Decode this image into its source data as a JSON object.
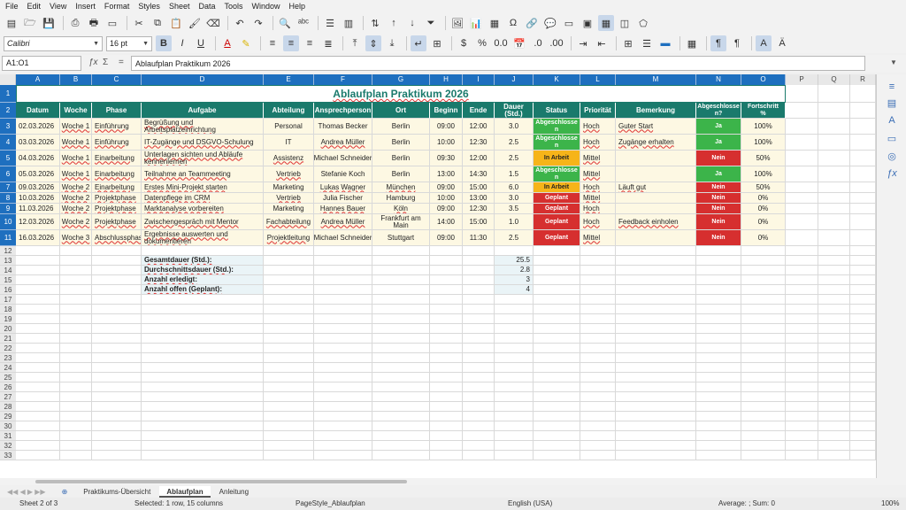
{
  "menu": [
    "File",
    "Edit",
    "View",
    "Insert",
    "Format",
    "Styles",
    "Sheet",
    "Data",
    "Tools",
    "Window",
    "Help"
  ],
  "font_name": "Calibri",
  "font_size": "16 pt",
  "name_box": "A1:O1",
  "formula": "Ablaufplan Praktikum 2026",
  "columns": [
    "A",
    "B",
    "C",
    "D",
    "E",
    "F",
    "G",
    "H",
    "I",
    "J",
    "K",
    "L",
    "M",
    "N",
    "O",
    "P",
    "Q",
    "R"
  ],
  "title": "Ablaufplan Praktikum 2026",
  "headers": [
    "Datum",
    "Woche",
    "Phase",
    "Aufgabe",
    "Abteilung",
    "Ansprechperson",
    "Ort",
    "Beginn",
    "Ende",
    "Dauer (Std.)",
    "Status",
    "Priorität",
    "Bemerkung",
    "Abgeschlosse n?",
    "Fortschritt %"
  ],
  "rows": [
    {
      "n": "3",
      "cells": [
        "02.03.2026",
        "Woche 1",
        "Einführung",
        "Begrüßung und Arbeitsplatzeinrichtung",
        "Personal",
        "Thomas Becker",
        "Berlin",
        "09:00",
        "12:00",
        "3.0",
        "Abgeschlosse n",
        "Hoch",
        "Guter Start",
        "Ja",
        "100%"
      ],
      "status": "green",
      "done": "green"
    },
    {
      "n": "4",
      "cells": [
        "03.03.2026",
        "Woche 1",
        "Einführung",
        "IT-Zugänge und DSGVO-Schulung",
        "IT",
        "Andrea Müller",
        "Berlin",
        "10:00",
        "12:30",
        "2.5",
        "Abgeschlosse n",
        "Hoch",
        "Zugänge erhalten",
        "Ja",
        "100%"
      ],
      "status": "green",
      "done": "green"
    },
    {
      "n": "5",
      "cells": [
        "04.03.2026",
        "Woche 1",
        "Einarbeitung",
        "Unterlagen sichten und Abläufe kennenlernen",
        "Assistenz",
        "Michael Schneider",
        "Berlin",
        "09:30",
        "12:00",
        "2.5",
        "In Arbeit",
        "Mittel",
        "",
        "Nein",
        "50%"
      ],
      "status": "orange",
      "done": "red"
    },
    {
      "n": "6",
      "cells": [
        "05.03.2026",
        "Woche 1",
        "Einarbeitung",
        "Teilnahme an Teammeeting",
        "Vertrieb",
        "Stefanie Koch",
        "Berlin",
        "13:00",
        "14:30",
        "1.5",
        "Abgeschlosse n",
        "Mittel",
        "",
        "Ja",
        "100%"
      ],
      "status": "green",
      "done": "green"
    },
    {
      "n": "7",
      "cells": [
        "09.03.2026",
        "Woche 2",
        "Einarbeitung",
        "Erstes Mini-Projekt starten",
        "Marketing",
        "Lukas Wagner",
        "München",
        "09:00",
        "15:00",
        "6.0",
        "In Arbeit",
        "Hoch",
        "Läuft gut",
        "Nein",
        "50%"
      ],
      "status": "orange",
      "done": "red"
    },
    {
      "n": "8",
      "cells": [
        "10.03.2026",
        "Woche 2",
        "Projektphase",
        "Datenpflege im CRM",
        "Vertrieb",
        "Julia Fischer",
        "Hamburg",
        "10:00",
        "13:00",
        "3.0",
        "Geplant",
        "Mittel",
        "",
        "Nein",
        "0%"
      ],
      "status": "red",
      "done": "red"
    },
    {
      "n": "9",
      "cells": [
        "11.03.2026",
        "Woche 2",
        "Projektphase",
        "Marktanalyse vorbereiten",
        "Marketing",
        "Hannes Bauer",
        "Köln",
        "09:00",
        "12:30",
        "3.5",
        "Geplant",
        "Hoch",
        "",
        "Nein",
        "0%"
      ],
      "status": "red",
      "done": "red"
    },
    {
      "n": "10",
      "cells": [
        "12.03.2026",
        "Woche 2",
        "Projektphase",
        "Zwischengespräch mit Mentor",
        "Fachabteilung",
        "Andrea Müller",
        "Frankfurt am Main",
        "14:00",
        "15:00",
        "1.0",
        "Geplant",
        "Hoch",
        "Feedback einholen",
        "Nein",
        "0%"
      ],
      "status": "red",
      "done": "red"
    },
    {
      "n": "11",
      "cells": [
        "16.03.2026",
        "Woche 3",
        "Abschlussphase",
        "Ergebnisse auswerten und dokumentieren",
        "Projektleitung",
        "Michael Schneider",
        "Stuttgart",
        "09:00",
        "11:30",
        "2.5",
        "Geplant",
        "Mittel",
        "",
        "Nein",
        "0%"
      ],
      "status": "red",
      "done": "red"
    }
  ],
  "summary": [
    {
      "n": "13",
      "label": "Gesamtdauer (Std.):",
      "value": "25.5"
    },
    {
      "n": "14",
      "label": "Durchschnittsdauer (Std.):",
      "value": "2.8"
    },
    {
      "n": "15",
      "label": "Anzahl erledigt:",
      "value": "3"
    },
    {
      "n": "16",
      "label": "Anzahl offen (Geplant):",
      "value": "4"
    }
  ],
  "empty_rows": [
    "17",
    "18",
    "19",
    "20",
    "21",
    "22",
    "23",
    "24",
    "25",
    "26",
    "27",
    "28",
    "29",
    "30",
    "31",
    "32",
    "33"
  ],
  "tabs": [
    "Praktikums-Übersicht",
    "Ablaufplan",
    "Anleitung"
  ],
  "active_tab": "Ablaufplan",
  "status": {
    "sheet": "Sheet 2 of 3",
    "selected": "Selected: 1 row, 15 columns",
    "pagestyle": "PageStyle_Ablaufplan",
    "language": "English (USA)",
    "sum": "Average: ; Sum: 0",
    "zoom": "100%"
  },
  "colors": {
    "header_teal": "#1a7a6c",
    "ok_green": "#3cb44a",
    "warn_orange": "#f6b419",
    "bad_red": "#d62f2f",
    "col_blue": "#1e6fbf"
  }
}
